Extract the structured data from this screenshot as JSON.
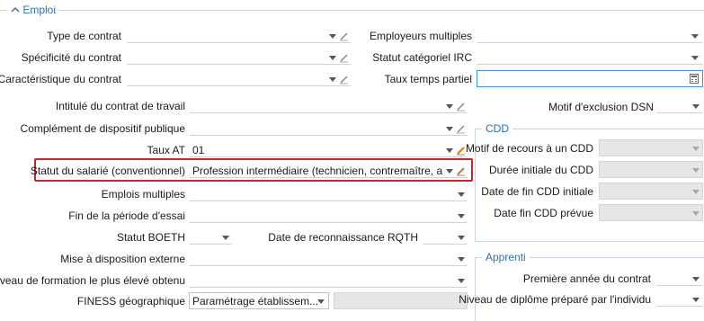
{
  "section_title": "Emploi",
  "top_left": {
    "type_contrat": "Type de contrat",
    "specificite": "Spécificité du contrat",
    "caracteristique": "Caractéristique du contrat"
  },
  "top_right": {
    "employeurs": "Employeurs multiples",
    "statut_irc": "Statut catégoriel IRC",
    "taux_temps": "Taux temps partiel"
  },
  "main": {
    "intitule": "Intitulé du contrat de travail",
    "complement": "Complément de dispositif publique",
    "taux_at": "Taux AT",
    "taux_at_value": "01",
    "statut_salarie": "Statut du salarié (conventionnel)",
    "statut_salarie_value": "Profession intermédiaire (technicien, contremaître, agent",
    "emplois_multiples": "Emplois multiples",
    "fin_periode": "Fin de la période d'essai",
    "statut_boeth": "Statut BOETH",
    "date_rqth": "Date de reconnaissance RQTH",
    "mise_disposition": "Mise à disposition externe",
    "niveau_formation": "Niveau de formation le plus élevé obtenu",
    "finess": "FINESS géographique",
    "finess_value": "Paramétrage établissem..."
  },
  "motif_exclusion": "Motif d'exclusion DSN",
  "cdd": {
    "title": "CDD",
    "motif": "Motif de recours à un CDD",
    "duree": "Durée initiale du CDD",
    "date_fin_initiale": "Date de fin CDD initiale",
    "date_fin_prevue": "Date fin CDD prévue"
  },
  "apprenti": {
    "title": "Apprenti",
    "premiere_annee": "Première année du contrat",
    "niveau_diplome": "Niveau de diplôme préparé par l'individu"
  },
  "colors": {
    "highlight": "#c0282d",
    "legend": "#2f6fb0"
  }
}
